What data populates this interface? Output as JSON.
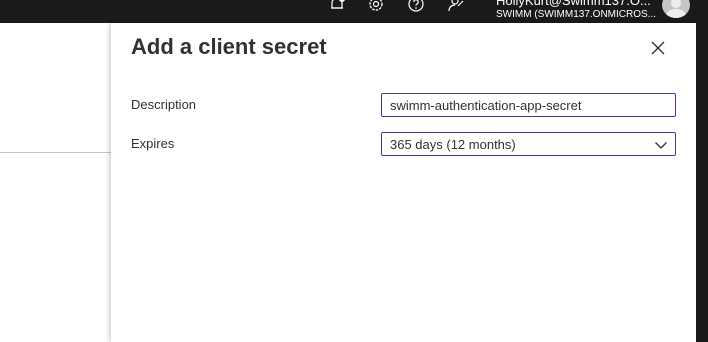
{
  "header": {
    "user_email": "HollyKurt@Swimm137.O...",
    "tenant": "SWIMM (SWIMM137.ONMICROS...",
    "icons": [
      "notifications-icon",
      "settings-icon",
      "help-icon",
      "feedback-icon"
    ]
  },
  "panel": {
    "title": "Add a client secret",
    "fields": {
      "description": {
        "label": "Description",
        "value": "swimm-authentication-app-secret"
      },
      "expires": {
        "label": "Expires",
        "selected": "365 days (12 months)"
      }
    }
  },
  "colors": {
    "topbar": "#1b1a19",
    "field_border": "#5c2d91",
    "text": "#323130"
  }
}
